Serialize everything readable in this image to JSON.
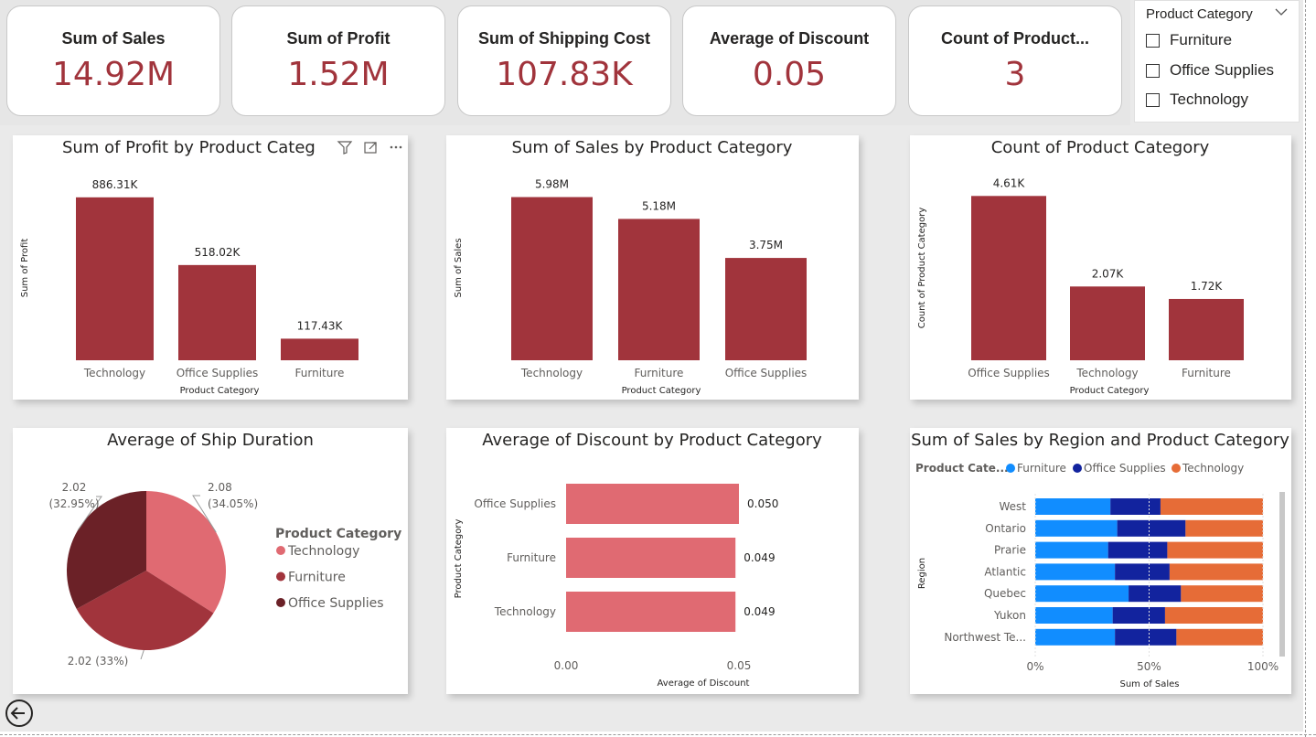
{
  "kpis": [
    {
      "title": "Sum of Sales",
      "value": "14.92M"
    },
    {
      "title": "Sum of Profit",
      "value": "1.52M"
    },
    {
      "title": "Sum of Shipping Cost",
      "value": "107.83K"
    },
    {
      "title": "Average of Discount",
      "value": "0.05"
    },
    {
      "title": "Count of Product...",
      "value": "3"
    }
  ],
  "slicer": {
    "title": "Product Category",
    "options": [
      "Furniture",
      "Office Supplies",
      "Technology"
    ]
  },
  "icons": [
    "filter-icon",
    "focus-mode-icon",
    "more-options-icon",
    "back-arrow-icon",
    "chevron-down-icon"
  ],
  "colors": {
    "bar": "#a1343c",
    "discount_bar": "#e06a72",
    "pie": [
      "#e06a72",
      "#a1343c",
      "#6b2127"
    ],
    "stack": [
      "#118dff",
      "#12239e",
      "#e66c37"
    ],
    "kpi_value": "#a1343c"
  },
  "chart_data": [
    {
      "type": "bar",
      "title": "Sum of Profit by Product Categ",
      "categories": [
        "Technology",
        "Office Supplies",
        "Furniture"
      ],
      "values": [
        886310,
        518020,
        117430
      ],
      "data_labels": [
        "886.31K",
        "518.02K",
        "117.43K"
      ],
      "xlabel": "Product Category",
      "ylabel": "Sum of Profit",
      "ylim": [
        0,
        950000
      ]
    },
    {
      "type": "bar",
      "title": "Sum of Sales by Product Category",
      "categories": [
        "Technology",
        "Furniture",
        "Office Supplies"
      ],
      "values": [
        5980000,
        5180000,
        3750000
      ],
      "data_labels": [
        "5.98M",
        "5.18M",
        "3.75M"
      ],
      "xlabel": "Product Category",
      "ylabel": "Sum of Sales",
      "ylim": [
        0,
        6400000
      ]
    },
    {
      "type": "bar",
      "title": "Count of Product Category",
      "categories": [
        "Office Supplies",
        "Technology",
        "Furniture"
      ],
      "values": [
        4610,
        2070,
        1720
      ],
      "data_labels": [
        "4.61K",
        "2.07K",
        "1.72K"
      ],
      "xlabel": "Product Category",
      "ylabel": "Count of Product Category",
      "ylim": [
        0,
        4900
      ]
    },
    {
      "type": "pie",
      "title": "Average of Ship Duration",
      "legend_title": "Product Category",
      "legend_position": "right",
      "slices": [
        {
          "label": "Technology",
          "value": 2.08,
          "label_value": "2.08",
          "label_percent": "(34.05%)"
        },
        {
          "label": "Furniture",
          "value": 2.02,
          "label_value": "2.02",
          "label_percent": "(33%)"
        },
        {
          "label": "Office Supplies",
          "value": 2.02,
          "label_value": "2.02",
          "label_percent": "(32.95%)"
        }
      ]
    },
    {
      "type": "bar",
      "orientation": "horizontal",
      "title": "Average of Discount by Product Category",
      "categories": [
        "Office Supplies",
        "Furniture",
        "Technology"
      ],
      "values": [
        0.05,
        0.049,
        0.049
      ],
      "data_labels": [
        "0.050",
        "0.049",
        "0.049"
      ],
      "xlabel": "Average of Discount",
      "ylabel": "Product Category",
      "xticks": [
        "0.00",
        "0.05"
      ],
      "xlim": [
        0,
        0.05
      ]
    },
    {
      "type": "bar",
      "orientation": "horizontal",
      "stacked": "percent",
      "title": "Sum of Sales by Region and Product Category",
      "legend_title": "Product Cate...",
      "legend_position": "top",
      "categories": [
        "West",
        "Ontario",
        "Prarie",
        "Atlantic",
        "Quebec",
        "Yukon",
        "Northwest Te..."
      ],
      "series": [
        {
          "name": "Furniture",
          "values": [
            33,
            36,
            32,
            35,
            41,
            34,
            35
          ]
        },
        {
          "name": "Office Supplies",
          "values": [
            22,
            30,
            26,
            24,
            23,
            23,
            27
          ]
        },
        {
          "name": "Technology",
          "values": [
            45,
            34,
            42,
            41,
            36,
            43,
            38
          ]
        }
      ],
      "xlabel": "Sum of Sales",
      "ylabel": "Region",
      "xticks": [
        "0%",
        "50%",
        "100%"
      ],
      "xlim": [
        0,
        100
      ]
    }
  ]
}
